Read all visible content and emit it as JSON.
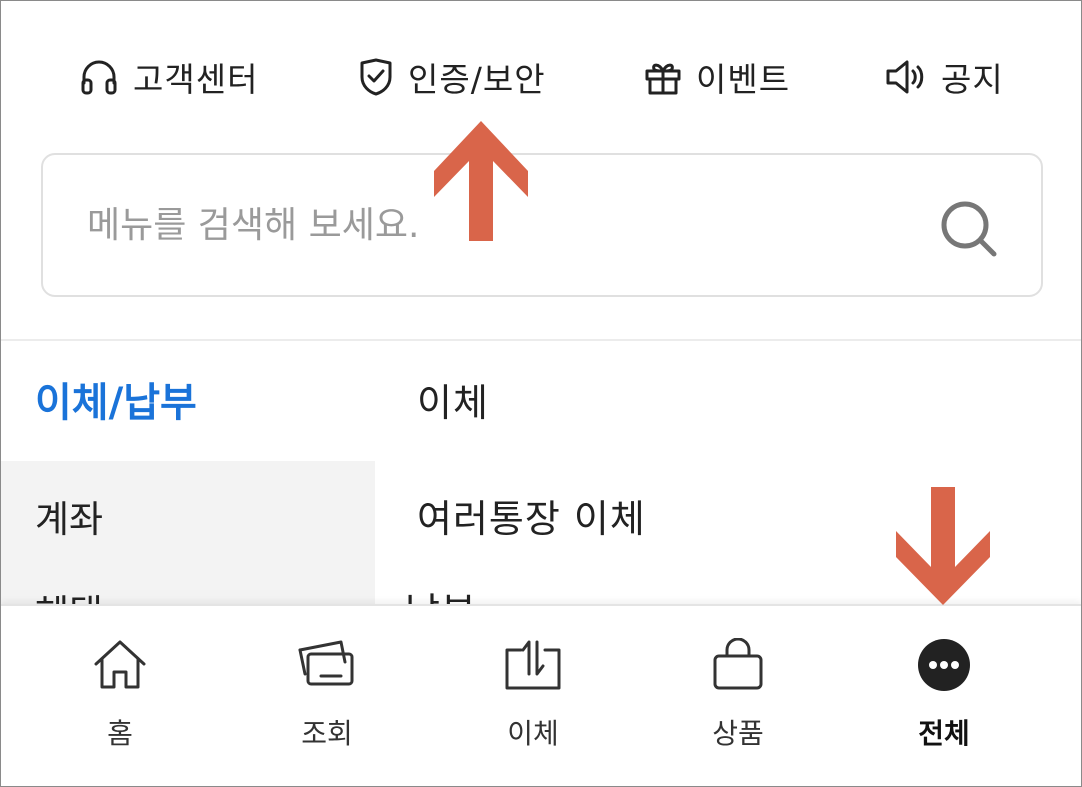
{
  "top_links": [
    {
      "label": "고객센터",
      "icon": "headphones-icon"
    },
    {
      "label": "인증/보안",
      "icon": "shield-check-icon"
    },
    {
      "label": "이벤트",
      "icon": "gift-icon"
    },
    {
      "label": "공지",
      "icon": "speaker-icon"
    }
  ],
  "search": {
    "placeholder": "메뉴를 검색해 보세요.",
    "value": "",
    "icon": "search-icon"
  },
  "categories": [
    {
      "label": "이체/납부",
      "state": "selected"
    },
    {
      "label": "계좌"
    },
    {
      "label": "혜택"
    }
  ],
  "menu_items": [
    {
      "label": "이체"
    },
    {
      "label": "여러통장 이체"
    },
    {
      "label": "납부"
    }
  ],
  "bottom_nav": [
    {
      "label": "홈",
      "icon": "home-icon"
    },
    {
      "label": "조회",
      "icon": "cards-icon"
    },
    {
      "label": "이체",
      "icon": "transfer-icon"
    },
    {
      "label": "상품",
      "icon": "shopping-bag-icon"
    },
    {
      "label": "전체",
      "icon": "more-icon",
      "state": "selected"
    }
  ],
  "colors": {
    "accent": "#1a73d9",
    "annotation_arrow": "#d9654a",
    "active_nav_icon": "#222222"
  }
}
